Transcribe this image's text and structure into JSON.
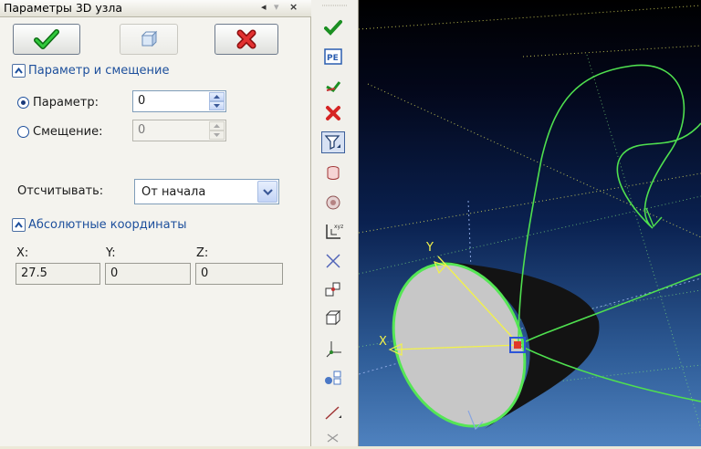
{
  "panel": {
    "title": "Параметры 3D узла",
    "title_controls": [
      "◂",
      "▾",
      "×"
    ],
    "buttons": {
      "ok_icon": "checkmark-icon",
      "mid_icon": "view-cube-icon",
      "cancel_icon": "cross-icon"
    },
    "section1": {
      "label": "Параметр и смещение"
    },
    "param": {
      "label": "Параметр:",
      "value": "0",
      "selected": true
    },
    "offset": {
      "label": "Смещение:",
      "value": "0",
      "selected": false
    },
    "count_from": {
      "label": "Отсчитывать:",
      "value": "От начала"
    },
    "section2": {
      "label": "Абсолютные координаты"
    },
    "coords": {
      "x": {
        "label": "X:",
        "value": "27.5"
      },
      "y": {
        "label": "Y:",
        "value": "0"
      },
      "z": {
        "label": "Z:",
        "value": "0"
      }
    }
  },
  "toolbar": {
    "icons": [
      "checkmark-icon",
      "pe-icon",
      "green-arrow-icon",
      "red-cross-icon",
      "filter-icon",
      "cylinder-icon",
      "sphere-icon",
      "lcs-icon",
      "cross-lines-icon",
      "cube-link-icon",
      "cube-icon",
      "axes-icon",
      "node-link-icon",
      "line-icon",
      "small-axes-icon"
    ]
  },
  "viewport": {
    "axis_labels": [
      "Y",
      "X"
    ],
    "colors": {
      "curve": "#4fe04f",
      "cone": "#111111",
      "ellipse_fill": "#c8c8c8",
      "axis": "#f2f24a",
      "node": "#e0372a"
    }
  }
}
